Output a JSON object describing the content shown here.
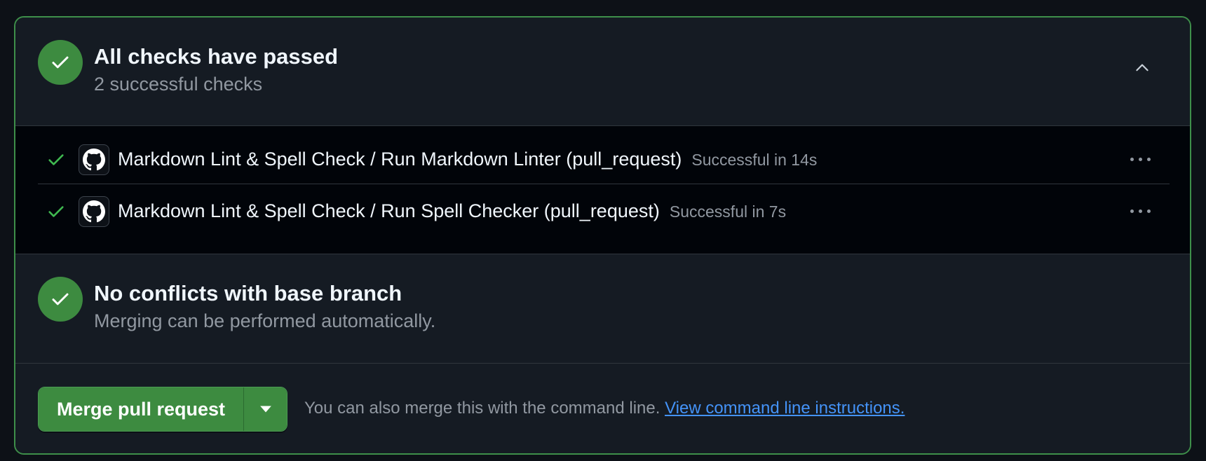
{
  "checks_summary": {
    "title": "All checks have passed",
    "subtitle": "2 successful checks",
    "status_icon": "check-icon",
    "collapse_icon": "chevron-up-icon"
  },
  "checks": [
    {
      "name": "Markdown Lint & Spell Check / Run Markdown Linter (pull_request)",
      "status": "Successful in 14s",
      "icon": "github-logo-icon"
    },
    {
      "name": "Markdown Lint & Spell Check / Run Spell Checker (pull_request)",
      "status": "Successful in 7s",
      "icon": "github-logo-icon"
    }
  ],
  "conflicts": {
    "title": "No conflicts with base branch",
    "subtitle": "Merging can be performed automatically."
  },
  "merge": {
    "button_label": "Merge pull request",
    "note": "You can also merge this with the command line.",
    "link_text": "View command line instructions."
  },
  "colors": {
    "success": "#3d8b40",
    "border_accent": "#3e8f4a",
    "link": "#4493f8",
    "background": "#0d1117",
    "panel": "#151b23",
    "muted_text": "#9198a1"
  }
}
